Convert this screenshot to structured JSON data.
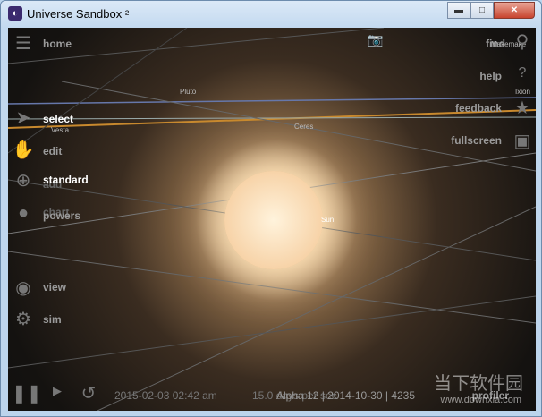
{
  "window": {
    "title": "Universe Sandbox ²",
    "minimize": "▬",
    "maximize": "□",
    "close": "✕"
  },
  "left_menu": [
    {
      "label": "home",
      "icon": "menu-icon"
    },
    {
      "label": "select",
      "icon": "cursor-icon"
    },
    {
      "label": "edit",
      "icon": "hand-icon"
    },
    {
      "label": "standard",
      "icon": "add-icon"
    },
    {
      "label": "add",
      "icon": ""
    },
    {
      "label": "chart",
      "icon": ""
    },
    {
      "label": "powers",
      "icon": "powers-icon"
    },
    {
      "label": "view",
      "icon": "eye-icon"
    },
    {
      "label": "sim",
      "icon": "gear-icon"
    }
  ],
  "right_menu": [
    {
      "label": "find",
      "icon": "search-icon"
    },
    {
      "label": "help",
      "icon": "question-icon"
    },
    {
      "label": "feedback",
      "icon": "star-icon"
    },
    {
      "label": "fullscreen",
      "icon": "fullscreen-icon"
    }
  ],
  "bodies": {
    "pluto": "Pluto",
    "vesta": "Vesta",
    "ceres": "Ceres",
    "sun": "Sun",
    "ixion": "Ixion",
    "makemake": "Makemake"
  },
  "bottom": {
    "date": "2015-02-03 02:42 am",
    "speed": "15.0 days per sec",
    "version": "Alpha 12 | 2014-10-30 | 4235",
    "profiler": "profiler"
  },
  "watermark": {
    "cn": "当下软件园",
    "url": "www.downxia.com"
  }
}
